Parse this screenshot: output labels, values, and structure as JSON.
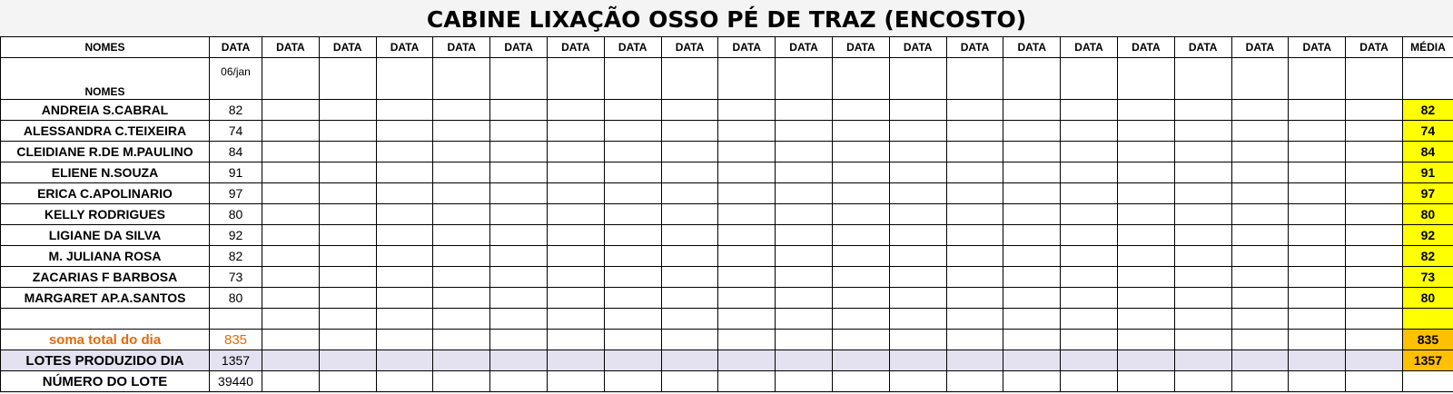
{
  "title": "CABINE LIXAÇÃO OSSO PÉ DE TRAZ (ENCOSTO)",
  "header": {
    "names_label": "NOMES",
    "date_label": "DATA",
    "date_columns": 21,
    "media_label": "MÉDIA"
  },
  "subheader": {
    "names_label": "NOMES",
    "first_date": "06/jan"
  },
  "rows": [
    {
      "name": "ANDREIA S.CABRAL",
      "value": "82",
      "media": "82"
    },
    {
      "name": "ALESSANDRA C.TEIXEIRA",
      "value": "74",
      "media": "74"
    },
    {
      "name": "CLEIDIANE R.DE M.PAULINO",
      "value": "84",
      "media": "84"
    },
    {
      "name": "ELIENE N.SOUZA",
      "value": "91",
      "media": "91"
    },
    {
      "name": "ERICA C.APOLINARIO",
      "value": "97",
      "media": "97"
    },
    {
      "name": "KELLY RODRIGUES",
      "value": "80",
      "media": "80"
    },
    {
      "name": "LIGIANE DA SILVA",
      "value": "92",
      "media": "92"
    },
    {
      "name": "M. JULIANA ROSA",
      "value": "82",
      "media": "82"
    },
    {
      "name": "ZACARIAS F BARBOSA",
      "value": "73",
      "media": "73"
    },
    {
      "name": "MARGARET AP.A.SANTOS",
      "value": "80",
      "media": "80"
    },
    {
      "name": "",
      "value": "",
      "media": ""
    }
  ],
  "soma": {
    "label": "soma total  do dia",
    "value": "835",
    "media": "835"
  },
  "lotes": {
    "label": "LOTES PRODUZIDO DIA",
    "value": "1357",
    "media": "1357"
  },
  "numero": {
    "label": "NÚMERO DO LOTE",
    "value": "39440",
    "media": ""
  },
  "colors": {
    "media_fill": "#ffff00",
    "total_fill": "#ffc000",
    "soma_text": "#e26b0a",
    "lotes_fill": "#e4e1f0"
  }
}
